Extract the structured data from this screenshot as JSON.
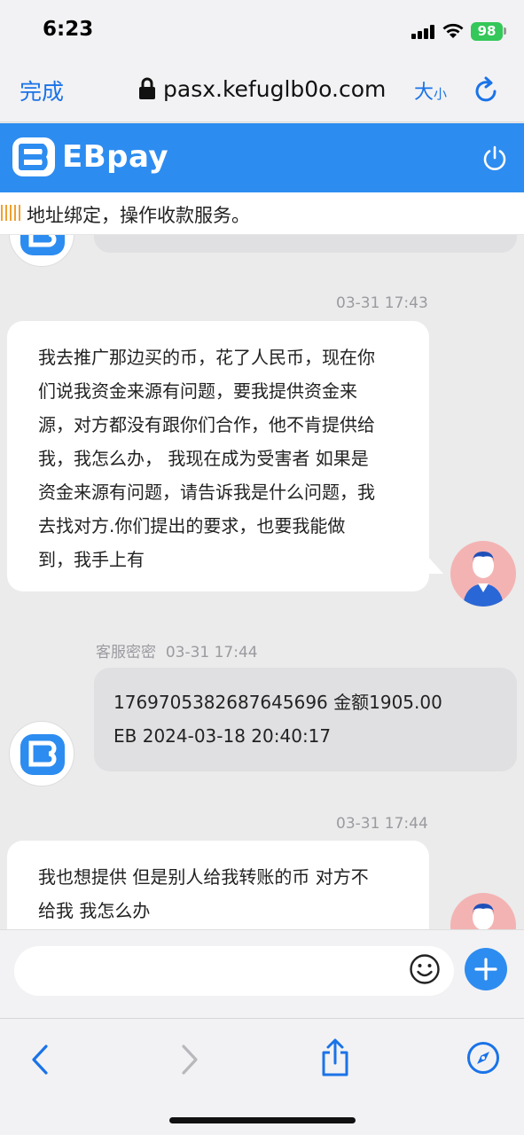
{
  "status_bar": {
    "time": "6:23",
    "battery": "98"
  },
  "browser": {
    "done_label": "完成",
    "url": "pasx.kefuglb0o.com",
    "text_size_big": "大",
    "text_size_small": "小"
  },
  "app": {
    "logo_text": "EBpay",
    "notice_text": "地址绑定，操作收款服务。",
    "brand_color": "#2d8cf0"
  },
  "chat": {
    "messages": [
      {
        "timestamp": "03-31 17:43",
        "lines": [
          "我去推广那边买的币，花了人民币，现在你",
          "们说我资金来源有问题，要我提供资金来",
          "源，对方都没有跟你们合作，他不肯提供给",
          "我，我怎么办， 我现在成为受害者 如果是",
          "资金来源有问题，请告诉我是什么问题，我",
          "去找对方.你们提出的要求，也要我能做",
          "到，我手上有"
        ]
      },
      {
        "sender": "客服密密",
        "timestamp": "03-31 17:44",
        "lines": [
          "1769705382687645696 金额1905.00",
          "EB 2024-03-18 20:40:17"
        ]
      },
      {
        "timestamp": "03-31 17:44",
        "lines": [
          "我也想提供 但是别人给我转账的币 对方不",
          "给我 我怎么办"
        ]
      }
    ]
  },
  "input": {
    "placeholder": ""
  },
  "icons": {
    "back": "chevron-left-icon",
    "forward": "chevron-right-icon",
    "share": "share-icon",
    "compass": "compass-icon",
    "emoji": "smiley-icon",
    "add": "plus-icon",
    "power": "power-icon",
    "lock": "lock-icon",
    "reload": "reload-icon"
  }
}
